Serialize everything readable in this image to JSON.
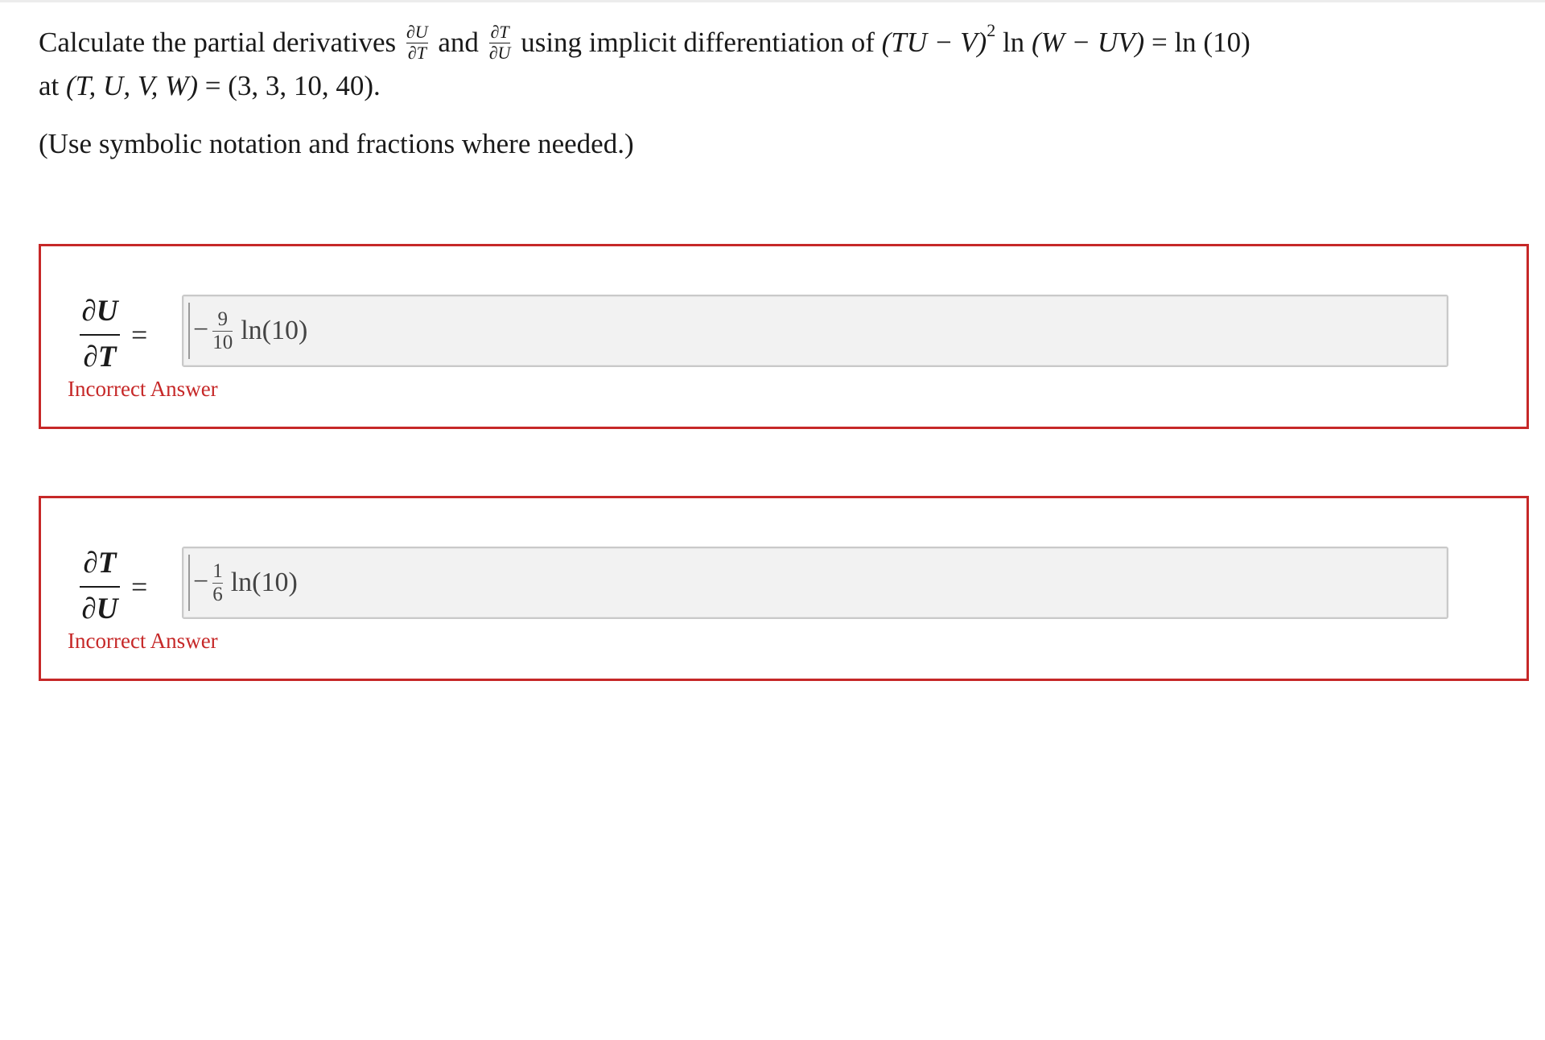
{
  "question": {
    "intro": "Calculate the partial derivatives",
    "frac1_num": "∂U",
    "frac1_den": "∂T",
    "and": "and",
    "frac2_num": "∂T",
    "frac2_den": "∂U",
    "mid": "using implicit differentiation of",
    "eq_left": "(TU − V)",
    "eq_exp": "2",
    "eq_ln": "ln",
    "eq_arg": "(W − UV)",
    "eq_equals": "=",
    "eq_right": "ln (10)",
    "line2_at": "at",
    "line2_point": "(T, U, V, W)",
    "line2_equals": "=",
    "line2_values": "(3, 3, 10, 40).",
    "hint": "(Use symbolic notation and fractions where needed.)"
  },
  "answers": [
    {
      "lhs_num": "∂U",
      "lhs_den": "∂T",
      "equals": "=",
      "sign": "−",
      "frac_num": "9",
      "frac_den": "10",
      "tail": "ln(10)",
      "feedback": "Incorrect Answer"
    },
    {
      "lhs_num": "∂T",
      "lhs_den": "∂U",
      "equals": "=",
      "sign": "−",
      "frac_num": "1",
      "frac_den": "6",
      "tail": "ln(10)",
      "feedback": "Incorrect Answer"
    }
  ],
  "colors": {
    "error_red": "#c62828",
    "input_bg": "#f2f2f2"
  }
}
